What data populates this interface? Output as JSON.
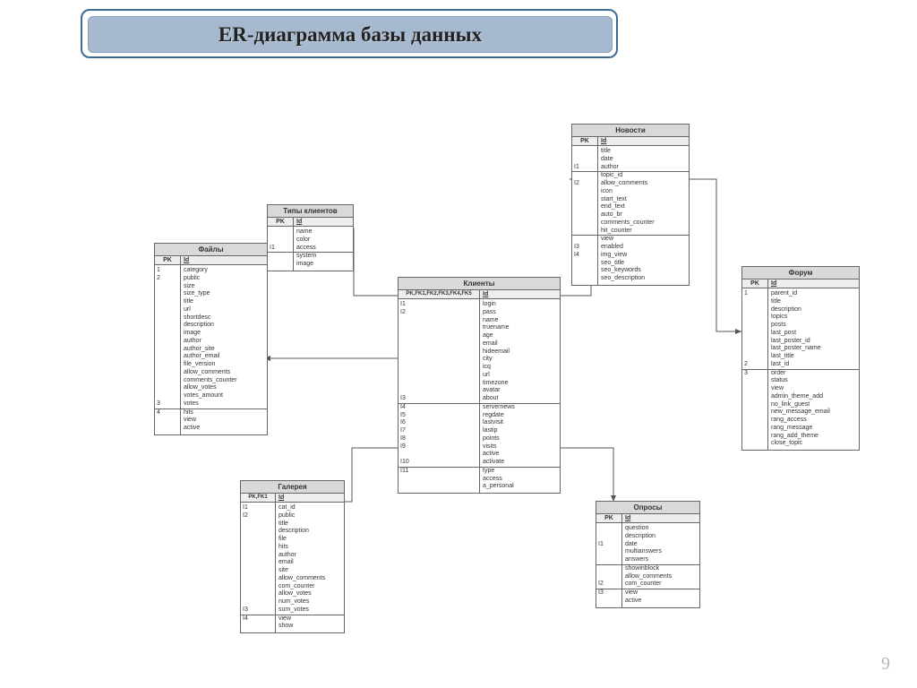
{
  "title": "ER-диаграмма базы данных",
  "slide_number": "9",
  "pk_header": "PK",
  "id_header": "Id",
  "entities": {
    "types": {
      "name": "Типы клиентов",
      "keys": [
        "",
        "",
        "I1"
      ],
      "sections": [
        [
          "name",
          "color",
          "access"
        ],
        [
          "system",
          "image"
        ]
      ]
    },
    "files": {
      "name": "Файлы",
      "keys": [
        "1",
        "2",
        "",
        "",
        "",
        "",
        "",
        "",
        "",
        "",
        "",
        "",
        "",
        "",
        "",
        "",
        "",
        "3",
        "4"
      ],
      "sections": [
        [
          "category",
          "public",
          "size",
          "size_type",
          "title",
          "url",
          "shortdesc",
          "description",
          "image",
          "author",
          "author_site",
          "author_email",
          "file_version",
          "allow_comments",
          "comments_counter",
          "allow_votes",
          "votes_amount",
          "votes"
        ],
        [
          "hits",
          "view",
          "active"
        ]
      ]
    },
    "clients": {
      "name": "Клиенты",
      "pk_label": "PK,FK1,FK2,FK3,FK4,FK5",
      "keys": [
        "I1",
        "I2",
        "",
        "",
        "",
        "",
        "",
        "",
        "",
        "",
        "",
        "",
        "I3",
        "I4",
        "I5",
        "I6",
        "I7",
        "I8",
        "I9",
        "",
        "I10",
        "I11"
      ],
      "sections": [
        [
          "login",
          "pass",
          "name",
          "truename",
          "age",
          "email",
          "hideemail",
          "city",
          "icq",
          "url",
          "timezone",
          "avatar",
          "about"
        ],
        [
          "servernews",
          "regdate",
          "lastvisit",
          "lastip",
          "points",
          "visits",
          "active",
          "activate"
        ],
        [
          "type",
          "access",
          "a_personal"
        ]
      ]
    },
    "news": {
      "name": "Новости",
      "keys": [
        "",
        "",
        "I1",
        "",
        "I2",
        "",
        "",
        "",
        "",
        "",
        "",
        "",
        "I3",
        "I4"
      ],
      "sections": [
        [
          "title",
          "date",
          "author"
        ],
        [
          "topic_id",
          "allow_comments",
          "icon",
          "start_text",
          "end_text",
          "auto_br",
          "comments_counter",
          "hit_counter"
        ],
        [
          "view",
          "enabled",
          "img_view",
          "seo_title",
          "seo_keywords",
          "seo_description"
        ]
      ]
    },
    "forum": {
      "name": "Форум",
      "keys": [
        "1",
        "",
        "",
        "",
        "",
        "",
        "",
        "",
        "",
        "2",
        "3"
      ],
      "sections": [
        [
          "parent_id",
          "title",
          "description",
          "topics",
          "posts",
          "last_post",
          "last_poster_id",
          "last_poster_name",
          "last_title",
          "last_id"
        ],
        [
          "order",
          "status",
          "view",
          "admin_theme_add",
          "no_link_guest",
          "new_message_email",
          "rang_access",
          "rang_message",
          "rang_add_theme",
          "close_topic"
        ]
      ]
    },
    "gallery": {
      "name": "Галерея",
      "keys": [
        "I1",
        "I2",
        "",
        "",
        "",
        "",
        "",
        "",
        "",
        "",
        "",
        "",
        "",
        "I3",
        "I4"
      ],
      "sections": [
        [
          "cat_id",
          "public",
          "title",
          "description",
          "file",
          "hits",
          "author",
          "email",
          "site",
          "allow_comments",
          "com_counter",
          "allow_votes",
          "num_votes",
          "sum_votes"
        ],
        [
          "view",
          "show"
        ]
      ]
    },
    "polls": {
      "name": "Опросы",
      "keys": [
        "",
        "",
        "I1",
        "",
        "",
        "",
        "",
        "I2",
        "I3"
      ],
      "sections": [
        [
          "question",
          "description",
          "date",
          "multianswers",
          "answers"
        ],
        [
          "showinblock",
          "allow_comments",
          "com_counter"
        ],
        [
          "view",
          "active"
        ]
      ]
    }
  }
}
